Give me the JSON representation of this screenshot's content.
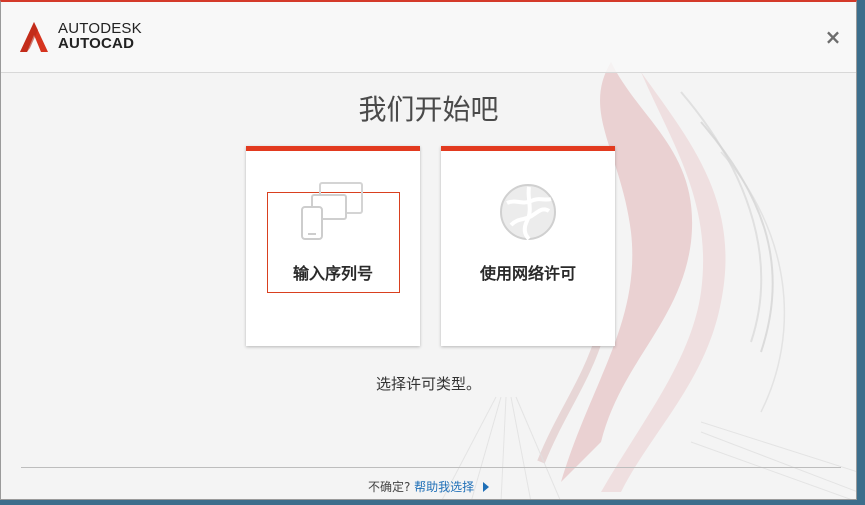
{
  "header": {
    "brand_line1": "AUTODESK",
    "brand_line2": "AUTOCAD",
    "close_glyph": "×",
    "logo_icon": "autodesk-a-logo"
  },
  "main": {
    "title": "我们开始吧",
    "cards": [
      {
        "label": "输入序列号",
        "icon": "devices-icon",
        "focused": true
      },
      {
        "label": "使用网络许可",
        "icon": "network-globe-icon",
        "focused": false
      }
    ],
    "subtitle": "选择许可类型。"
  },
  "footer": {
    "prompt": "不确定?",
    "help_link": "帮助我选择"
  },
  "colors": {
    "accent": "#e23a1f",
    "link": "#1f6fb7"
  }
}
